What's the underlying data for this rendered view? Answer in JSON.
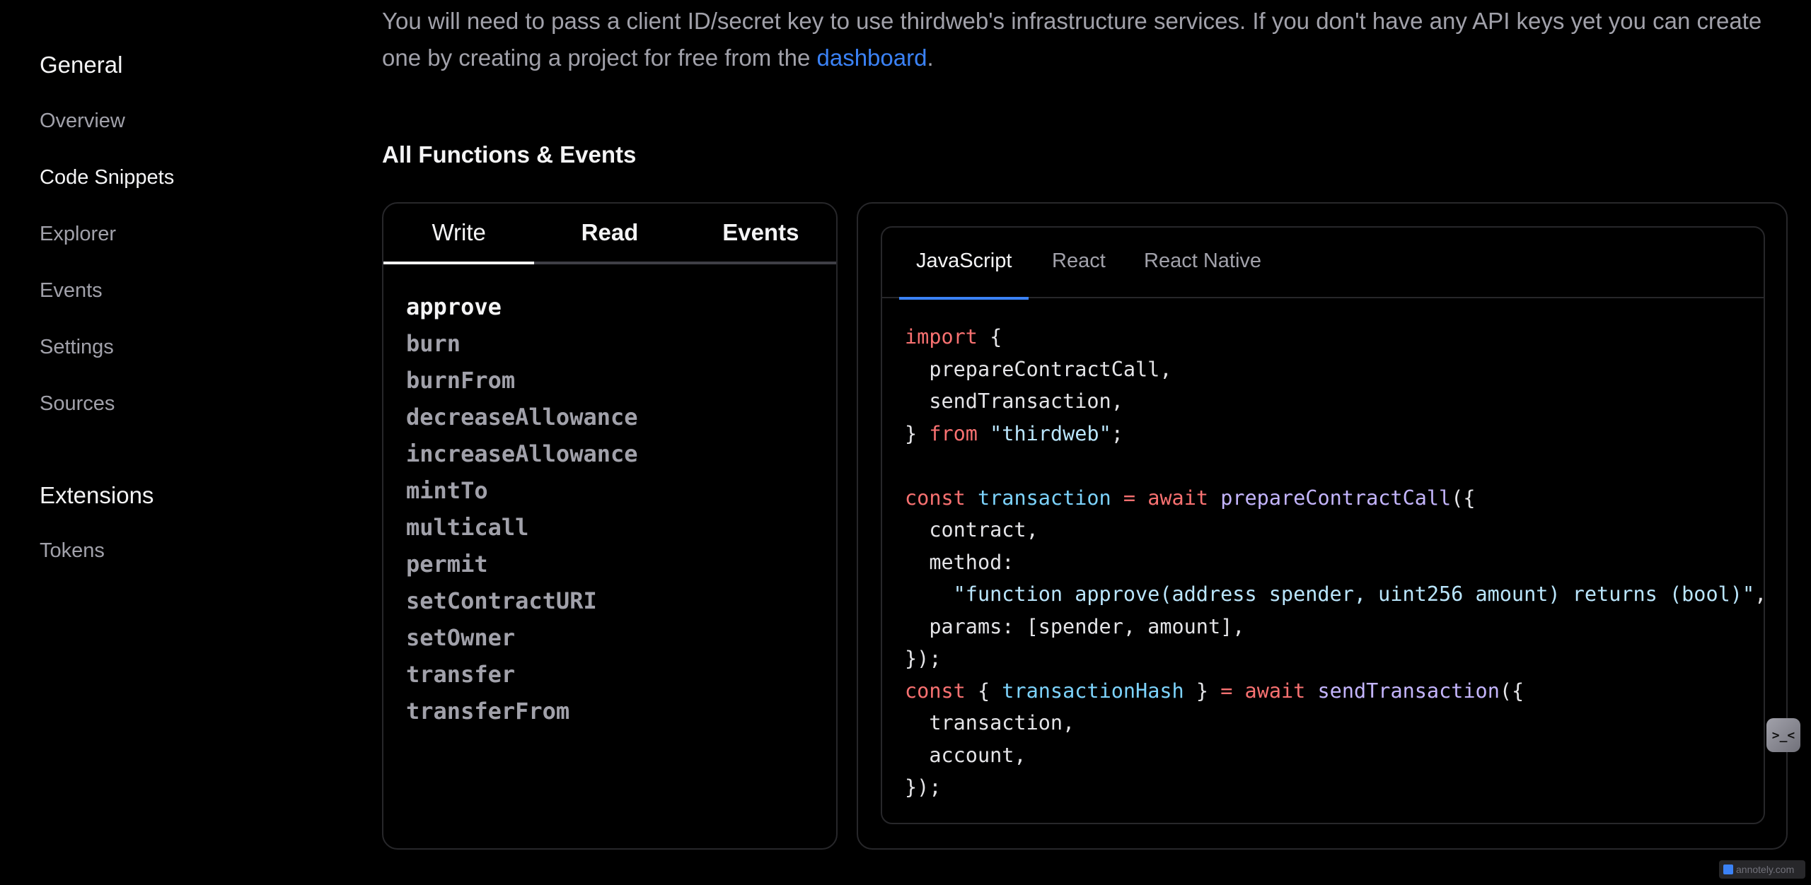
{
  "sidebar": {
    "general_heading": "General",
    "general_items": [
      "Overview",
      "Code Snippets",
      "Explorer",
      "Events",
      "Settings",
      "Sources"
    ],
    "extensions_heading": "Extensions",
    "extensions_items": [
      "Tokens"
    ]
  },
  "intro": {
    "text_before_link": "You will need to pass a client ID/secret key to use thirdweb's infrastructure services. If you don't have any API keys yet you can create one by creating a project for free from the ",
    "link_text": "dashboard",
    "text_after_link": "."
  },
  "section_title": "All Functions & Events",
  "function_tabs": [
    "Write",
    "Read",
    "Events"
  ],
  "functions": [
    "approve",
    "burn",
    "burnFrom",
    "decreaseAllowance",
    "increaseAllowance",
    "mintTo",
    "multicall",
    "permit",
    "setContractURI",
    "setOwner",
    "transfer",
    "transferFrom"
  ],
  "language_tabs": [
    "JavaScript",
    "React",
    "React Native"
  ],
  "code": {
    "import_kw": "import",
    "open_brace": " {",
    "import_line1": "  prepareContractCall,",
    "import_line2": "  sendTransaction,",
    "close_brace": "} ",
    "from_kw": "from",
    "module_str": "\"thirdweb\"",
    "semicolon": ";",
    "const_kw": "const",
    "transaction_var": "transaction",
    "equals": "=",
    "await_kw": "await",
    "prepare_fn": "prepareContractCall",
    "call_open": "({",
    "contract_line": "  contract,",
    "method_line": "  method:",
    "indent": "    ",
    "method_str": "\"function approve(address spender, uint256 amount) returns (bool)\"",
    "comma": ",",
    "params_line": "  params: [spender, amount],",
    "call_close": "});",
    "destructure_open": "{ ",
    "hash_var": "transactionHash",
    "destructure_close": " }",
    "send_fn": "sendTransaction",
    "transaction_line": "  transaction,",
    "account_line": "  account,"
  },
  "float_button_glyph": ">_<",
  "watermark_text": "annotely.com",
  "colors": {
    "link": "#3b82f6",
    "keyword": "#f87171",
    "function": "#c4b5fd",
    "string": "#bae6fd",
    "variable": "#7dd3fc"
  }
}
